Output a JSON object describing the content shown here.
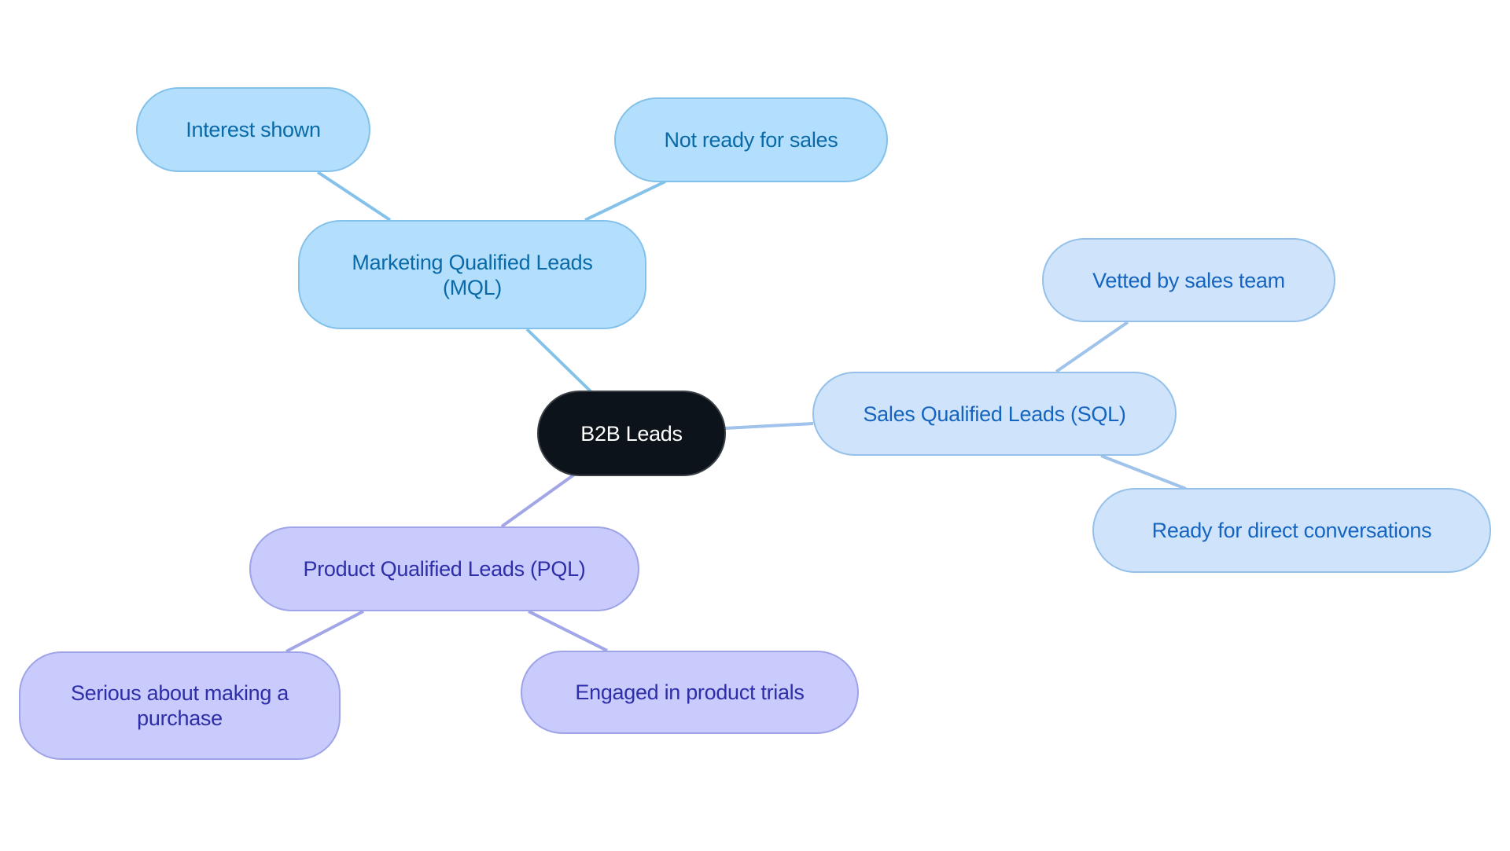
{
  "diagram": {
    "type": "mind-map",
    "root": {
      "id": "root",
      "label": "B2B Leads"
    },
    "branches": [
      {
        "id": "mql",
        "label": "Marketing Qualified Leads (MQL)",
        "color": "#b3dffc",
        "line_color": "#85c2ea",
        "text_color": "#0a6aa8",
        "children": [
          {
            "id": "mql-1",
            "label": "Interest shown"
          },
          {
            "id": "mql-2",
            "label": "Not ready for sales"
          }
        ]
      },
      {
        "id": "sql",
        "label": "Sales Qualified Leads (SQL)",
        "color": "#cfe4fa",
        "line_color": "#9fc3ea",
        "text_color": "#1565c0",
        "children": [
          {
            "id": "sql-1",
            "label": "Vetted by sales team"
          },
          {
            "id": "sql-2",
            "label": "Ready for direct conversations"
          }
        ]
      },
      {
        "id": "pql",
        "label": "Product Qualified Leads (PQL)",
        "color": "#c8cbfc",
        "line_color": "#a3a6e6",
        "text_color": "#2e2ea8",
        "children": [
          {
            "id": "pql-1",
            "label": "Serious about making a purchase"
          },
          {
            "id": "pql-2",
            "label": "Engaged in product trials"
          }
        ]
      }
    ]
  }
}
